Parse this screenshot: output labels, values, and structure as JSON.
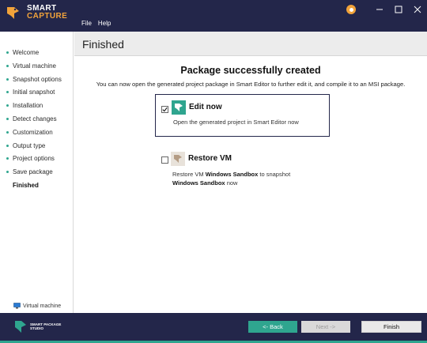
{
  "app": {
    "logo_line1": "SMART",
    "logo_line2": "CAPTURE",
    "menu": [
      "File",
      "Help"
    ]
  },
  "sidebar": {
    "steps": [
      {
        "label": "Welcome"
      },
      {
        "label": "Virtual machine"
      },
      {
        "label": "Snapshot options"
      },
      {
        "label": "Initial snapshot"
      },
      {
        "label": "Installation"
      },
      {
        "label": "Detect changes"
      },
      {
        "label": "Customization"
      },
      {
        "label": "Output type"
      },
      {
        "label": "Project options"
      },
      {
        "label": "Save package"
      },
      {
        "label": "Finished"
      }
    ],
    "vm_status_label": "Virtual machine"
  },
  "page": {
    "title": "Finished",
    "heading": "Package successfully created",
    "subtext": "You can now open the generated project package in Smart Editor to further edit it, and compile it to an MSI package."
  },
  "options": {
    "edit_now": {
      "title": "Edit now",
      "checked": true,
      "description": "Open the generated project in Smart Editor now"
    },
    "restore_vm": {
      "title": "Restore VM",
      "checked": false,
      "desc_prefix": "Restore VM ",
      "vm_name": "Windows Sandbox",
      "desc_middle": " to snapshot",
      "snapshot_name": "Windows Sandbox",
      "desc_suffix": " now"
    }
  },
  "footer": {
    "brand_line1": "SMART PACKAGE",
    "brand_line2": "STUDIO",
    "back_label": "<- Back",
    "next_label": "Next ->",
    "finish_label": "Finish"
  },
  "colors": {
    "navy": "#23264a",
    "accent_teal": "#2fa58f",
    "accent_orange": "#f2a33a"
  }
}
